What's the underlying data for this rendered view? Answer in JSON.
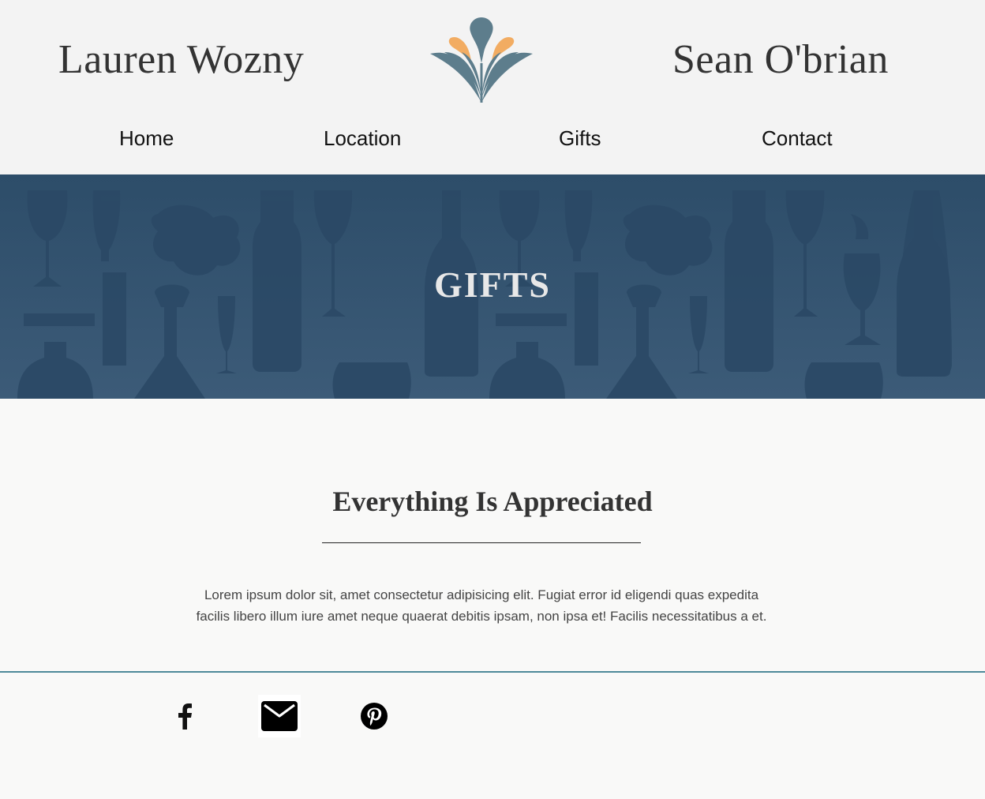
{
  "header": {
    "left_name": "Lauren Wozny",
    "right_name": "Sean O'brian",
    "logo_icon": "botanical-splash-logo"
  },
  "nav": {
    "items": [
      {
        "label": "Home"
      },
      {
        "label": "Location"
      },
      {
        "label": "Gifts"
      },
      {
        "label": "Contact"
      }
    ]
  },
  "banner": {
    "title": "GIFTS",
    "background_color": "#35536f"
  },
  "content": {
    "heading": "Everything Is Appreciated",
    "paragraph_line_1": "Lorem ipsum dolor sit, amet consectetur adipisicing elit. Fugiat error id eligendi quas expedita",
    "paragraph_line_2": "facilis libero illum iure amet neque quaerat debitis ipsam, non ipsa et! Facilis necessitatibus a et."
  },
  "footer": {
    "accent_color": "#4f8a99",
    "social": [
      {
        "icon": "facebook-icon"
      },
      {
        "icon": "mail-icon"
      },
      {
        "icon": "pinterest-icon"
      }
    ]
  },
  "colors": {
    "logo_teal": "#5d7d8c",
    "logo_orange": "#f2ac62"
  }
}
